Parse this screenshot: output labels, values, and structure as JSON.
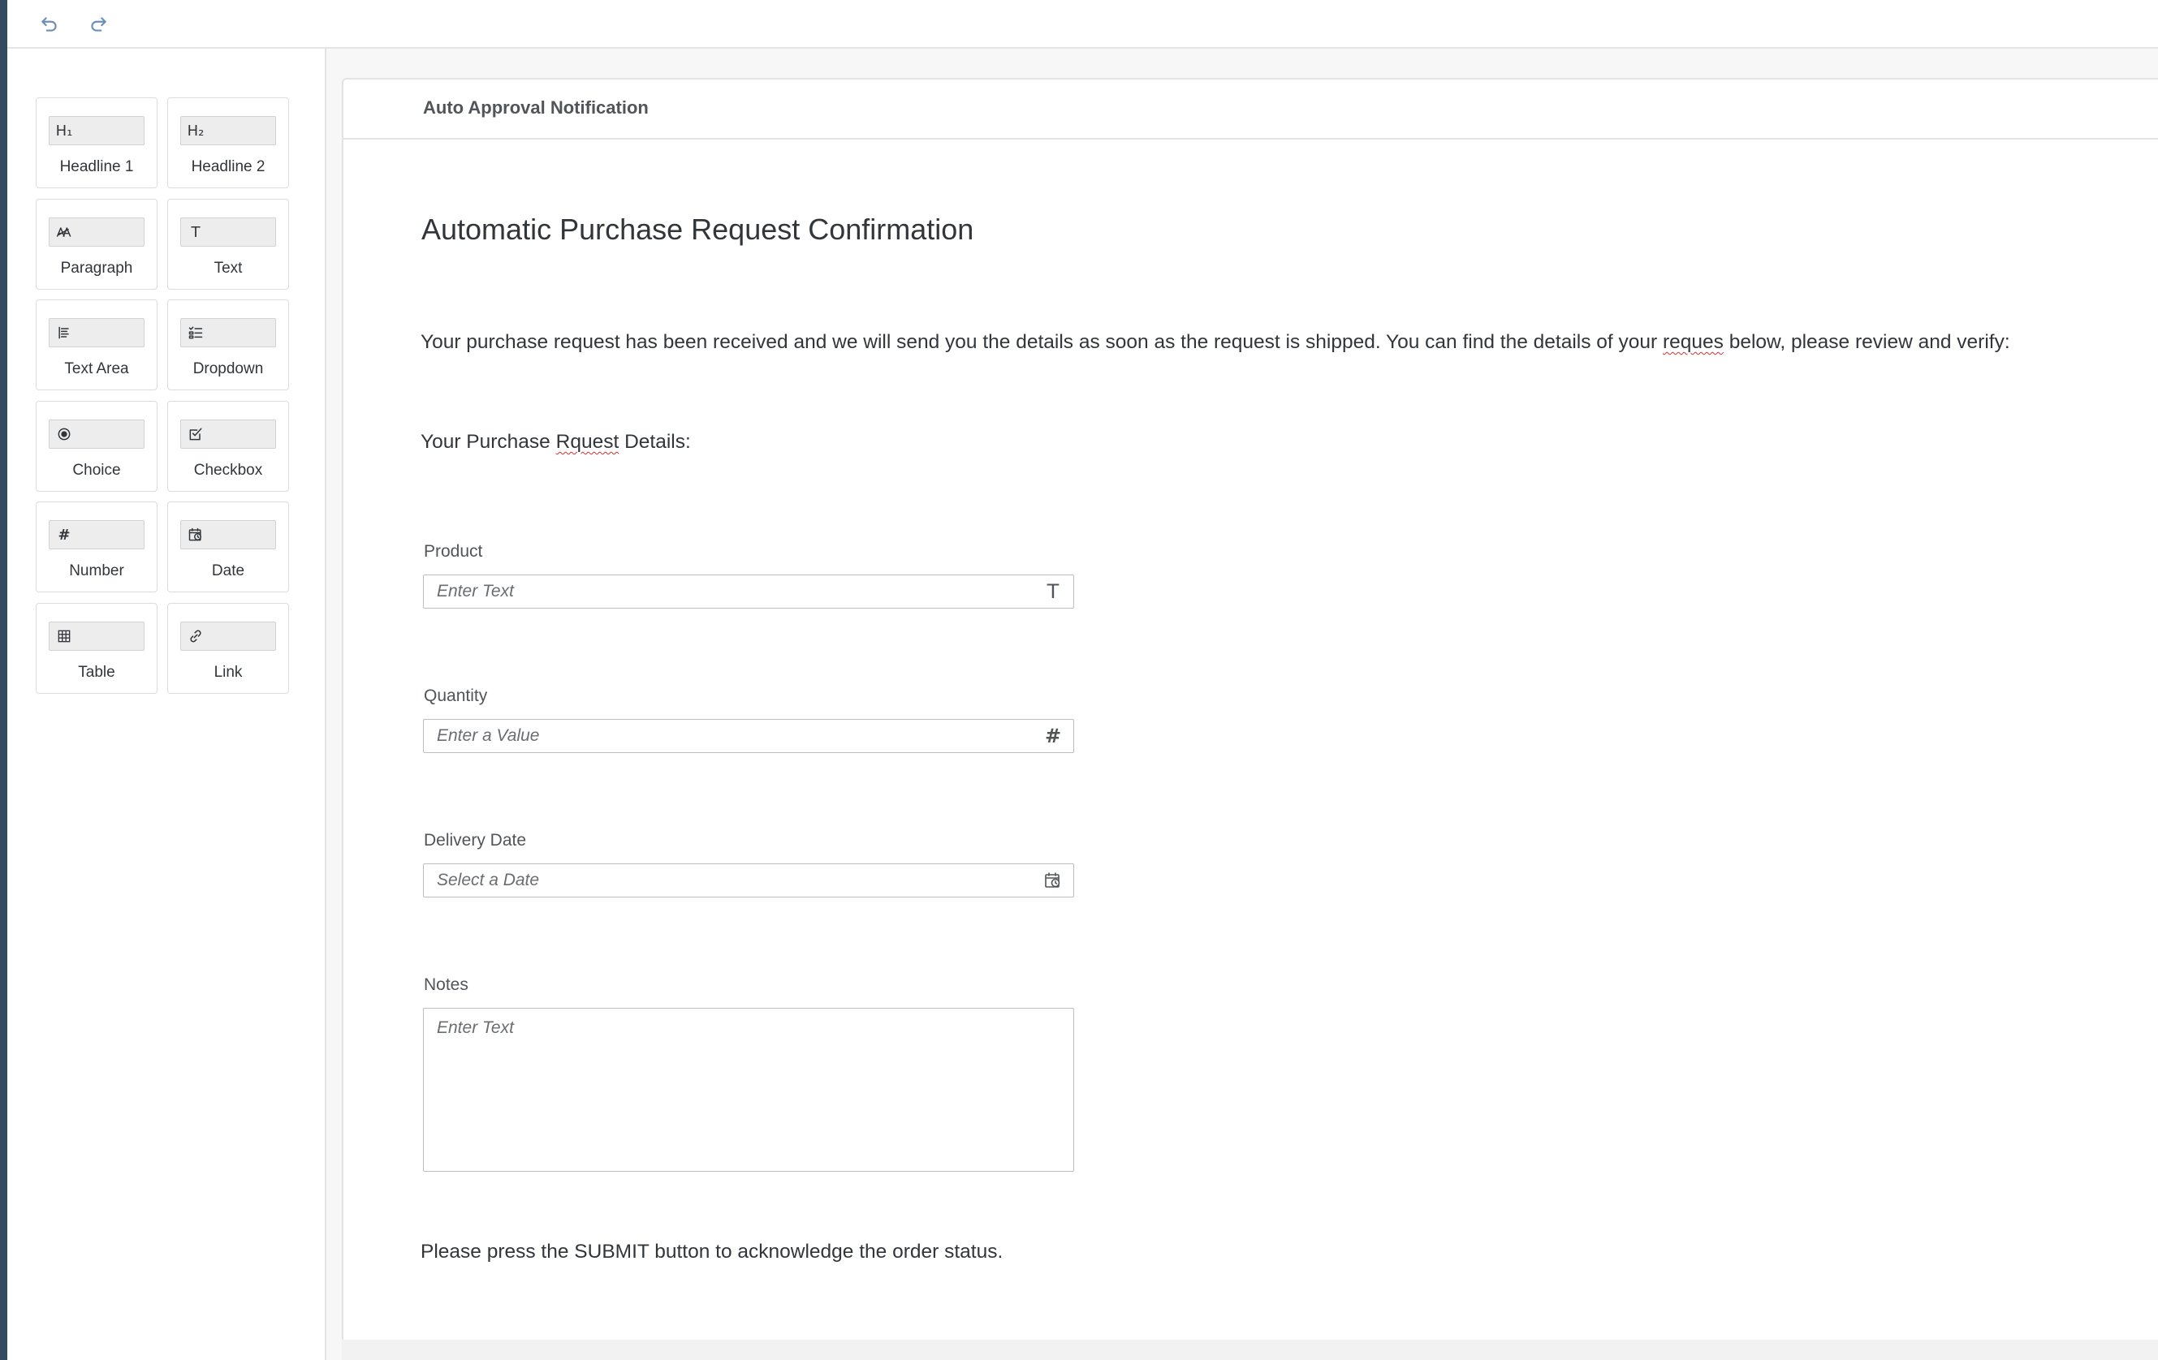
{
  "toolbar": {
    "undo_icon": "undo-icon",
    "redo_icon": "redo-icon",
    "icon_color": "#6c8fb8"
  },
  "palette": {
    "items": [
      {
        "label": "Headline 1",
        "icon": "headline-1-icon",
        "glyph": "H₁"
      },
      {
        "label": "Headline 2",
        "icon": "headline-2-icon",
        "glyph": "H₂"
      },
      {
        "label": "Paragraph",
        "icon": "paragraph-icon",
        "glyph": "A̸A"
      },
      {
        "label": "Text",
        "icon": "text-icon",
        "glyph": "T"
      },
      {
        "label": "Text Area",
        "icon": "text-area-icon",
        "glyph": ""
      },
      {
        "label": "Dropdown",
        "icon": "dropdown-icon",
        "glyph": ""
      },
      {
        "label": "Choice",
        "icon": "choice-icon",
        "glyph": ""
      },
      {
        "label": "Checkbox",
        "icon": "checkbox-icon",
        "glyph": ""
      },
      {
        "label": "Number",
        "icon": "number-icon",
        "glyph": "#"
      },
      {
        "label": "Date",
        "icon": "date-icon",
        "glyph": ""
      },
      {
        "label": "Table",
        "icon": "table-icon",
        "glyph": ""
      },
      {
        "label": "Link",
        "icon": "link-icon",
        "glyph": ""
      }
    ]
  },
  "canvas": {
    "title": "Auto Approval Notification",
    "heading": "Automatic Purchase Request Confirmation",
    "intro_before": "Your purchase request has been received and we will send you the details as soon as the request is shipped. You can find the details of your ",
    "intro_misspelled": "reques",
    "intro_after": " below, please review and verify:",
    "details_before": "Your Purchase ",
    "details_misspelled": "Rquest",
    "details_after": " Details:",
    "fields": {
      "product": {
        "label": "Product",
        "placeholder": "Enter Text",
        "suffix": "T"
      },
      "quantity": {
        "label": "Quantity",
        "placeholder": "Enter a Value",
        "suffix": "#"
      },
      "delivery_date": {
        "label": "Delivery Date",
        "placeholder": "Select a Date",
        "suffix_icon": "calendar-icon"
      },
      "notes": {
        "label": "Notes",
        "placeholder": "Enter Text"
      }
    },
    "footer_text": "Please press the SUBMIT button to acknowledge the order status."
  }
}
